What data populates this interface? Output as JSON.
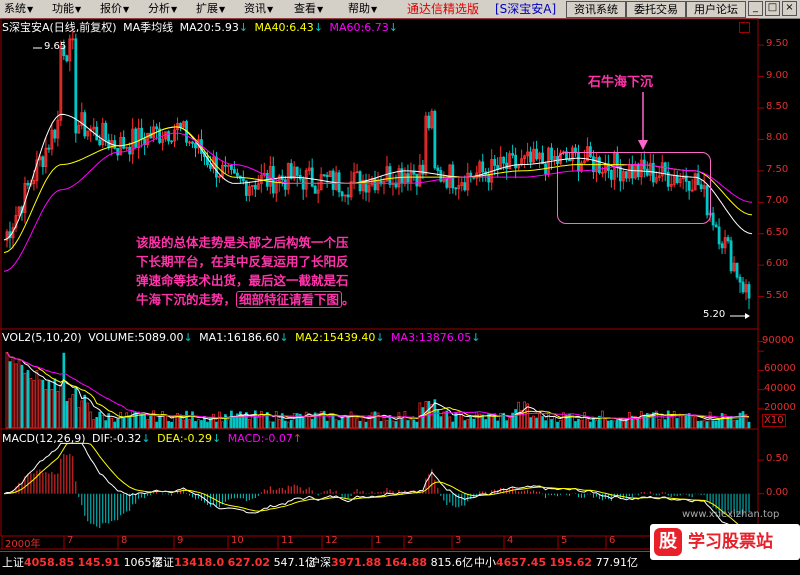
{
  "menubar": {
    "items": [
      {
        "label": "系统"
      },
      {
        "label": "功能"
      },
      {
        "label": "报价"
      },
      {
        "label": "分析"
      },
      {
        "label": "扩展"
      },
      {
        "label": "资讯"
      },
      {
        "label": "查看"
      },
      {
        "label": "帮助"
      }
    ],
    "brand": "通达信精选版",
    "stock": "[S深宝安A]",
    "buttons": [
      "资讯系统",
      "委托交易",
      "用户论坛"
    ],
    "win_min": "_",
    "win_max": "□",
    "win_close": "×"
  },
  "main_header": {
    "title": "S深宝安A(日线,前复权)",
    "indicator": "MA季均线",
    "ma20": "MA20:5.93",
    "ma40": "MA40:6.43",
    "ma60": "MA60:6.73",
    "high_label": "9.65",
    "low_label": "5.20"
  },
  "volume_header": {
    "title": "VOL2(5,10,20)",
    "volume": "VOLUME:5089.00",
    "ma1": "MA1:16186.60",
    "ma2": "MA2:15439.40",
    "ma3": "MA3:13876.05",
    "scale": "X10"
  },
  "macd_header": {
    "title": "MACD(12,26,9)",
    "dif": "DIF:-0.32",
    "dea": "DEA:-0.29",
    "macd": "MACD:-0.07"
  },
  "annotation": {
    "line1": "该股的总体走势是头部之后构筑一个压",
    "line2": "下长期平台，在其中反复运用了长阳反",
    "line3": "弹速命等技术出货，最后这一截就是石",
    "line4": "牛海下沉的走势，",
    "highlight": "细部特征请看下图",
    "tail": "。",
    "callout": "石牛海下沉"
  },
  "x_labels": [
    "2000年",
    "7",
    "8",
    "9",
    "10",
    "11",
    "12",
    "1",
    "2",
    "3",
    "4",
    "5",
    "6",
    "7"
  ],
  "statusbar": {
    "sh_name": "上证",
    "sh_val": "4058.85",
    "sh_chg": "145.91",
    "sh_amt": "1065亿",
    "sz_name": "深证",
    "sz_val": "13418.0",
    "sz_chg": "627.02",
    "sz_amt": "547.1亿",
    "hs_name": "沪深",
    "hs_val": "3971.88",
    "hs_chg": "164.88",
    "hs_amt": "815.6亿",
    "zx_name": "中小",
    "zx_val": "4657.45",
    "zx_chg": "195.62",
    "zx_amt": "77.91亿"
  },
  "watermark": {
    "badge": "股",
    "text": "学习股票站",
    "url": "www.xuexizhan.top"
  },
  "colors": {
    "up": "#ff3030",
    "down": "#00c8c8",
    "ma20": "#ffffff",
    "ma40": "#ffff00",
    "ma60": "#ff00ff",
    "accent": "#ff33aa"
  },
  "chart_data": [
    {
      "type": "line",
      "title": "S深宝安A(日线,前复权)",
      "ylim": [
        5.0,
        9.9
      ],
      "yticks": [
        5.5,
        6.0,
        6.5,
        7.0,
        7.5,
        8.0,
        8.5,
        9.0,
        9.5
      ],
      "x": [
        "2000年",
        "7",
        "8",
        "9",
        "10",
        "11",
        "12",
        "1",
        "2",
        "3",
        "4",
        "5",
        "6",
        "7"
      ],
      "series": [
        {
          "name": "MA20",
          "values": [
            6.4,
            8.4,
            7.9,
            8.2,
            7.3,
            7.4,
            7.3,
            7.5,
            7.4,
            7.6,
            7.7,
            7.5,
            7.4,
            6.5
          ]
        },
        {
          "name": "MA40",
          "values": [
            6.2,
            7.6,
            7.9,
            8.2,
            7.4,
            7.3,
            7.3,
            7.4,
            7.4,
            7.5,
            7.6,
            7.6,
            7.5,
            6.8
          ]
        },
        {
          "name": "MA60",
          "values": [
            5.9,
            7.2,
            7.8,
            8.1,
            7.6,
            7.3,
            7.3,
            7.3,
            7.4,
            7.4,
            7.5,
            7.6,
            7.5,
            7.0
          ]
        }
      ],
      "annotations": [
        "9.65",
        "5.20"
      ]
    },
    {
      "type": "bar",
      "title": "VOL2(5,10,20)",
      "ylim": [
        0,
        100000
      ],
      "yticks": [
        20000,
        40000,
        60000,
        80000,
        90000
      ]
    },
    {
      "type": "bar",
      "title": "MACD(12,26,9)",
      "ylim": [
        -0.6,
        0.8
      ],
      "yticks": [
        0.0,
        0.5
      ]
    }
  ]
}
